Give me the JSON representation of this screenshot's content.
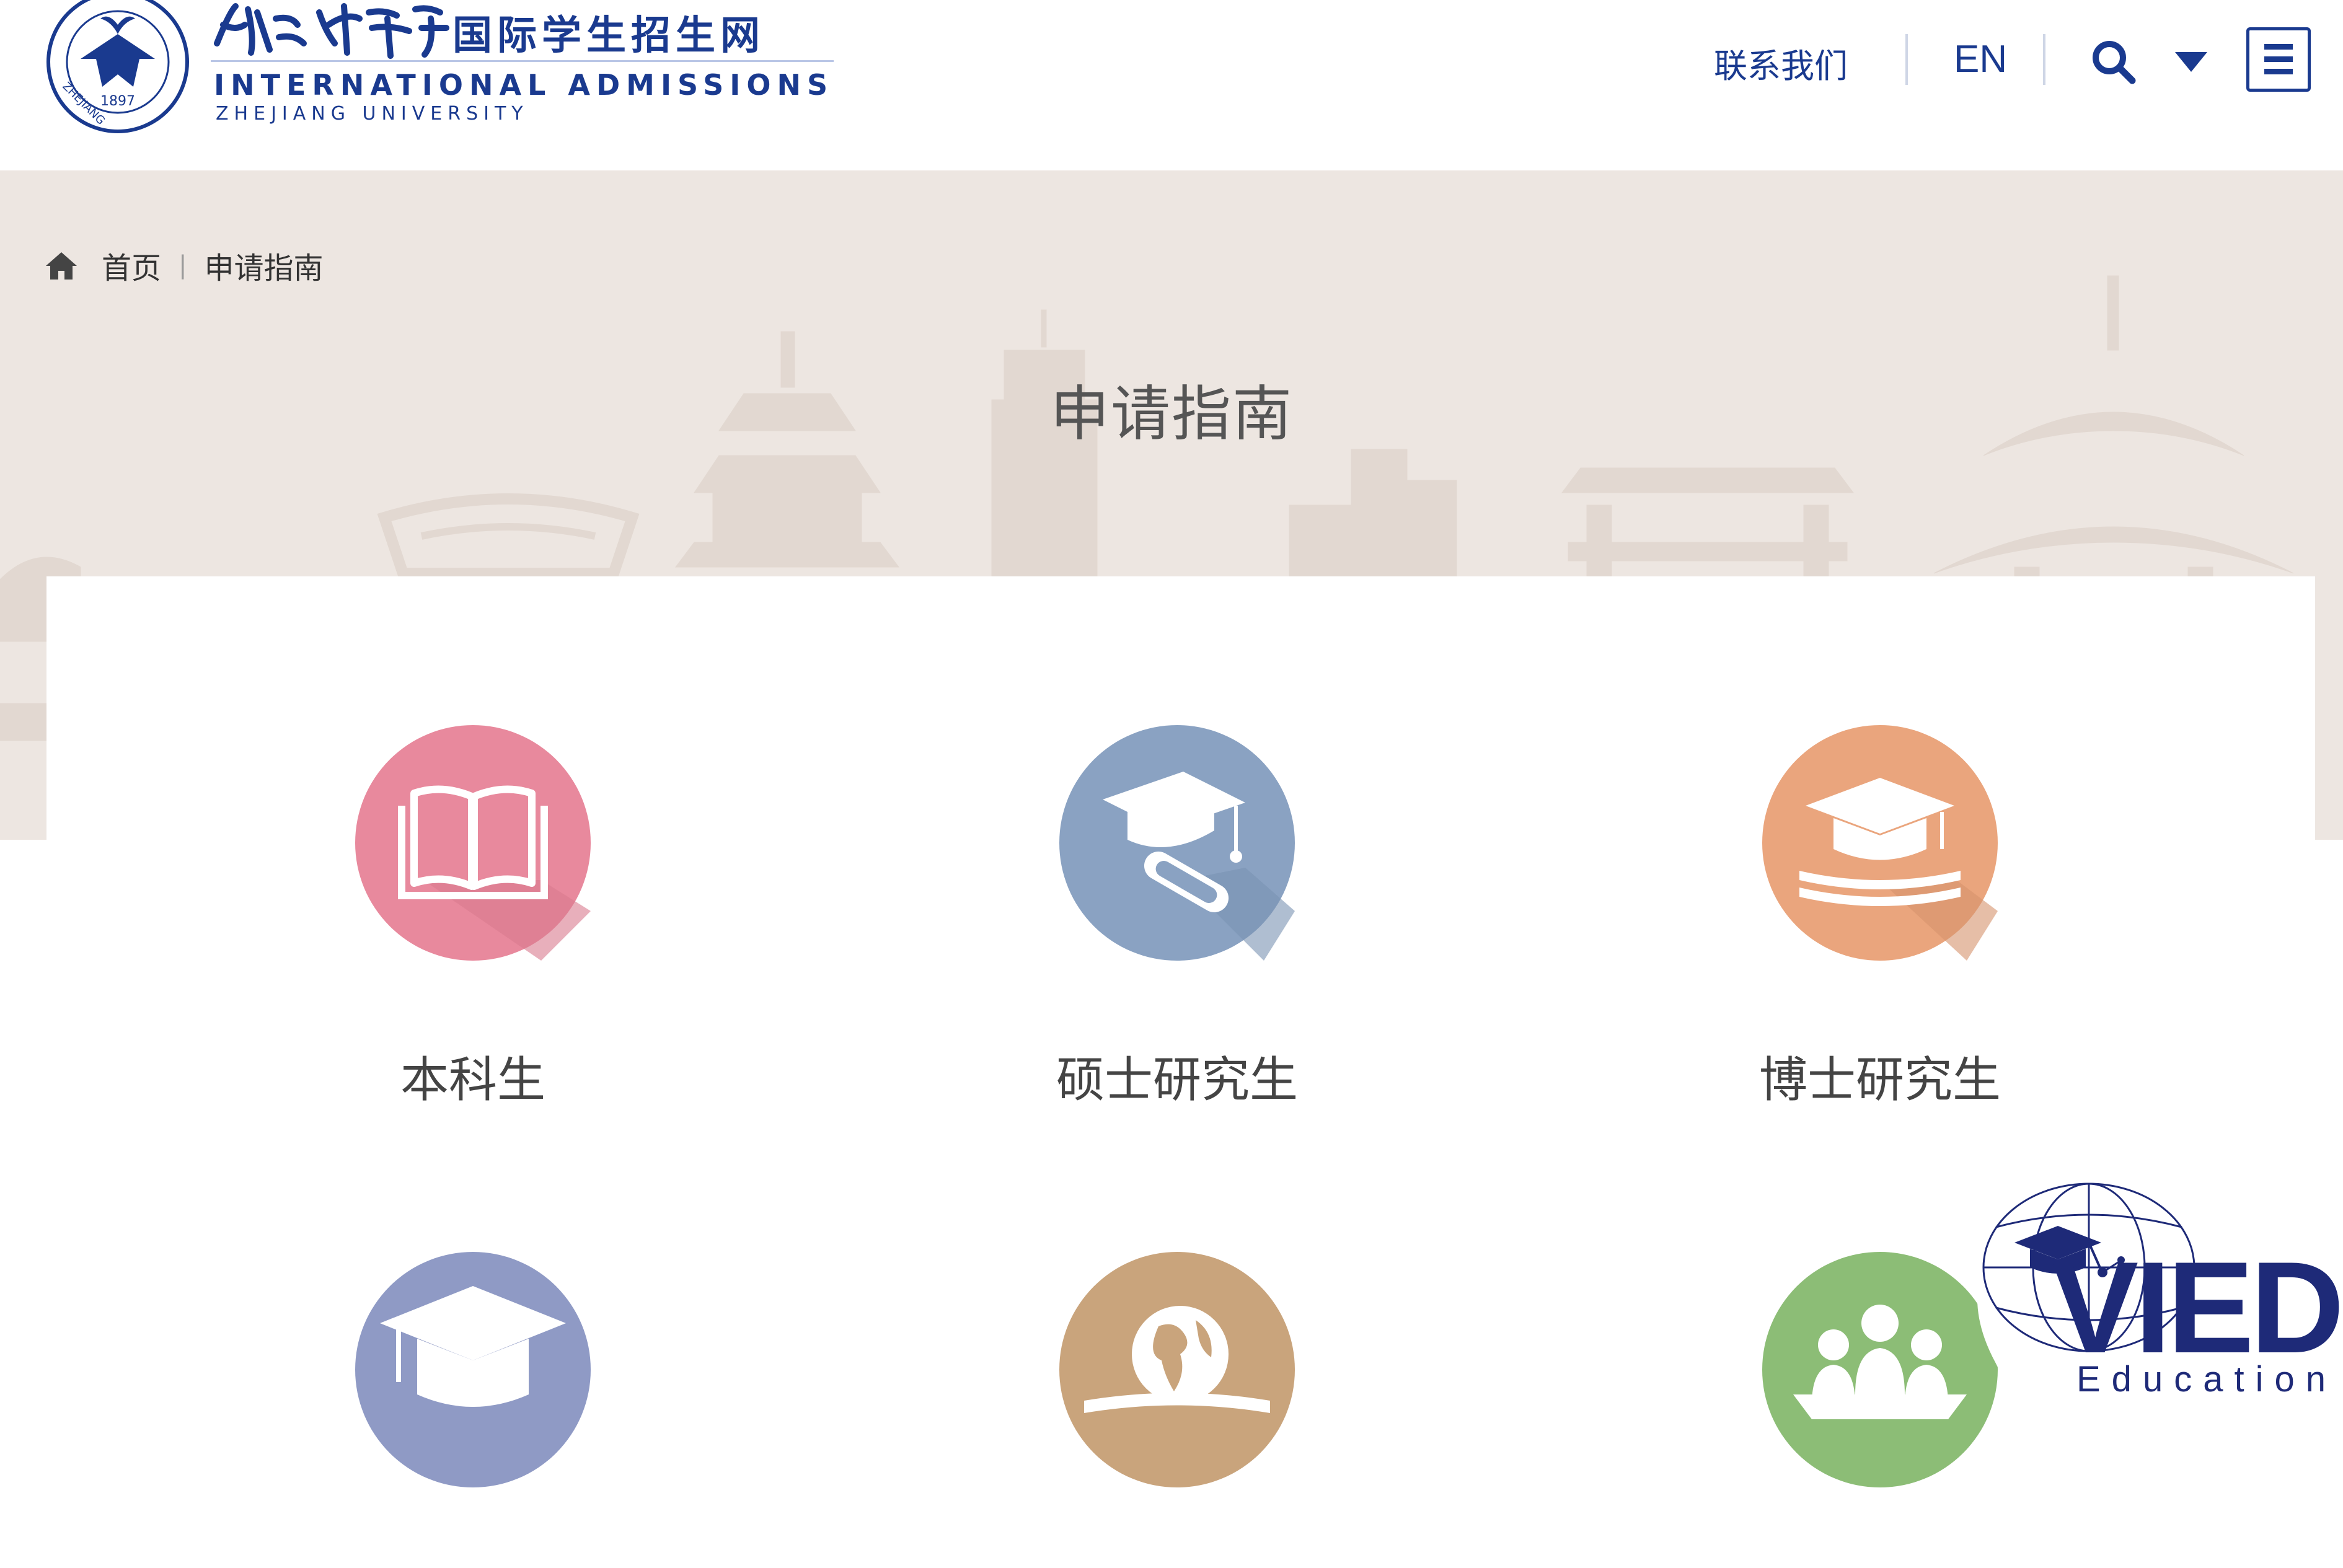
{
  "header": {
    "logo": {
      "seal_text": "ZHEJIANG UNIVERSITY",
      "seal_year": "1897",
      "calligraphy": "浙江大学",
      "title_cn": "国际学生招生网",
      "title_en": "INTERNATIONAL ADMISSIONS",
      "subtitle_en": "ZHEJIANG UNIVERSITY"
    },
    "nav": {
      "contact_label": "联系我们",
      "lang_label": "EN",
      "search_icon": "search-icon",
      "dropdown_icon": "caret-down-icon",
      "menu_icon": "hamburger-menu-icon"
    }
  },
  "breadcrumb": {
    "home_icon": "home-icon",
    "home_label": "首页",
    "separator": "|",
    "current": "申请指南"
  },
  "page_title": "申请指南",
  "options": [
    {
      "label": "本科生",
      "icon": "open-book-icon",
      "color": "#e8899d"
    },
    {
      "label": "硕士研究生",
      "icon": "graduation-cap-diploma-icon",
      "color": "#8aa2c2"
    },
    {
      "label": "博士研究生",
      "icon": "graduation-cap-books-icon",
      "color": "#eaa57d"
    },
    {
      "label": "",
      "icon": "graduation-cap-icon",
      "color": "#8f9ac5"
    },
    {
      "label": "",
      "icon": "globe-book-icon",
      "color": "#c9a47c"
    },
    {
      "label": "",
      "icon": "group-people-icon",
      "color": "#8cbd76"
    }
  ],
  "watermark": {
    "brand": "VIED",
    "sub": "Education"
  },
  "colors": {
    "brand_blue": "#1a3a8f",
    "banner_bg": "#ede6e1",
    "skyline": "#e0d6cf"
  }
}
